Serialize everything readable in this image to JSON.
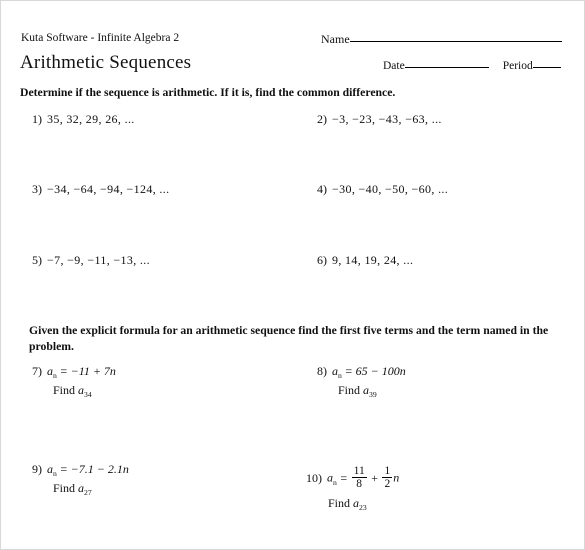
{
  "document": {
    "brand": "Kuta Software - Infinite Algebra 2",
    "title": "Arithmetic Sequences"
  },
  "header_fields": {
    "name_label": "Name",
    "date_label": "Date",
    "period_label": "Period"
  },
  "sections": [
    {
      "directions": "Determine if the sequence is arithmetic.  If it is, find the common difference."
    },
    {
      "directions": "Given the explicit formula for an arithmetic sequence find the first five terms and the term named in the problem."
    }
  ],
  "problems": {
    "p1": {
      "number": "1)",
      "sequence": "35,  32,  29,  26, ..."
    },
    "p2": {
      "number": "2)",
      "sequence": "−3,  −23,  −43,  −63, ..."
    },
    "p3": {
      "number": "3)",
      "sequence": "−34,  −64,  −94,  −124, ..."
    },
    "p4": {
      "number": "4)",
      "sequence": "−30,  −40,  −50,  −60, ..."
    },
    "p5": {
      "number": "5)",
      "sequence": "−7,  −9,  −11,  −13, ..."
    },
    "p6": {
      "number": "6)",
      "sequence": "9,  14,  19,  24, ..."
    },
    "p7": {
      "number": "7)",
      "term_var": "a",
      "term_sub": "n",
      "equals": "=",
      "expression": "−11 + 7n",
      "find_label": "Find",
      "find_var": "a",
      "find_sub": "34"
    },
    "p8": {
      "number": "8)",
      "term_var": "a",
      "term_sub": "n",
      "equals": "=",
      "expression": "65 − 100n",
      "find_label": "Find",
      "find_var": "a",
      "find_sub": "39"
    },
    "p9": {
      "number": "9)",
      "term_var": "a",
      "term_sub": "n",
      "equals": "=",
      "expression": "−7.1 − 2.1n",
      "find_label": "Find",
      "find_var": "a",
      "find_sub": "27"
    },
    "p10": {
      "number": "10)",
      "term_var": "a",
      "term_sub": "n",
      "equals": "=",
      "frac1_num": "11",
      "frac1_den": "8",
      "operator": "+",
      "frac2_num": "1",
      "frac2_den": "2",
      "trailing_var": "n",
      "find_label": "Find",
      "find_var": "a",
      "find_sub": "23"
    }
  }
}
